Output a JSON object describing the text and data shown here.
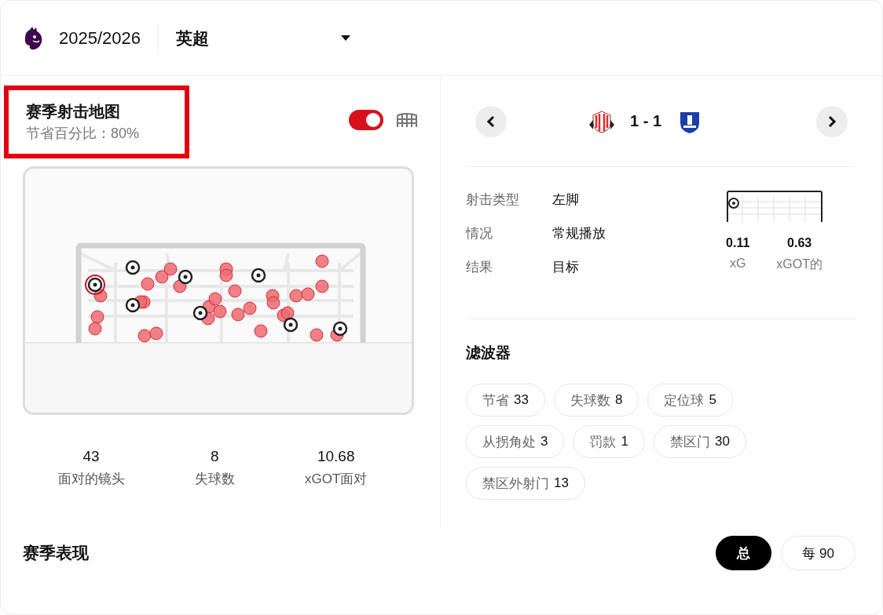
{
  "header": {
    "season": "2025/2026",
    "competition": "英超"
  },
  "shot_map": {
    "title": "赛季射击地图",
    "subtitle": "节省百分比：80%",
    "highlighted": true,
    "toggle": {
      "on": true
    },
    "stats": [
      {
        "value": "43",
        "label": "面对的镜头"
      },
      {
        "value": "8",
        "label": "失球数"
      },
      {
        "value": "10.68",
        "label": "xGOT面对"
      }
    ]
  },
  "shot_detail": {
    "score": "1 - 1",
    "rows": [
      {
        "label": "射击类型",
        "value": "左脚"
      },
      {
        "label": "情况",
        "value": "常规播放"
      },
      {
        "label": "结果",
        "value": "目标"
      }
    ],
    "xg": [
      {
        "value": "0.11",
        "label": "xG"
      },
      {
        "value": "0.63",
        "label": "xGOT的"
      }
    ]
  },
  "filters": {
    "title": "滤波器",
    "chips": [
      {
        "label": "节省",
        "count": "33"
      },
      {
        "label": "失球数",
        "count": "8"
      },
      {
        "label": "定位球",
        "count": "5"
      },
      {
        "label": "从拐角处",
        "count": "3"
      },
      {
        "label": "罚款",
        "count": "1"
      },
      {
        "label": "禁区门",
        "count": "30"
      },
      {
        "label": "禁区外射门",
        "count": "13"
      }
    ]
  },
  "season_performance": {
    "title": "赛季表现",
    "modes": [
      {
        "label": "总",
        "selected": true
      },
      {
        "label": "每 90",
        "selected": false
      }
    ]
  }
}
